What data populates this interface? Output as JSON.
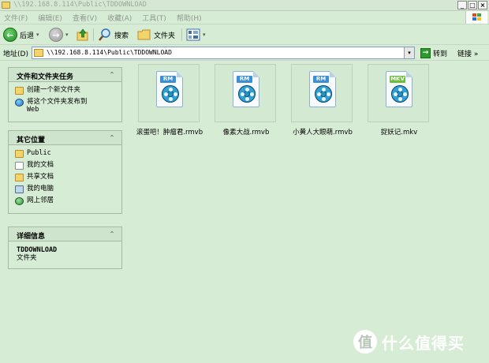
{
  "window": {
    "title": "\\\\192.168.8.114\\Public\\TDDOWNLOAD",
    "controls": [
      "_",
      "□",
      "×"
    ]
  },
  "menu": [
    "文件(F)",
    "编辑(E)",
    "查看(V)",
    "收藏(A)",
    "工具(T)",
    "帮助(H)"
  ],
  "toolbar": {
    "back_label": "后退",
    "search_label": "搜索",
    "folders_label": "文件夹",
    "back_glyph": "←",
    "forward_glyph": "→",
    "dropdown_glyph": "▾"
  },
  "address": {
    "label": "地址(D)",
    "value": "\\\\192.168.8.114\\Public\\TDDOWNLOAD",
    "go_label": "转到",
    "links_label": "链接",
    "links_chevron": "»",
    "dropdown_glyph": "▾"
  },
  "sidebar": {
    "tasks": {
      "title": "文件和文件夹任务",
      "chevron": "⌃",
      "items": [
        {
          "label": "创建一个新文件夹",
          "icon": "new-folder-icon"
        },
        {
          "label": "将这个文件夹发布到",
          "sub": "Web",
          "icon": "publish-web-icon"
        }
      ]
    },
    "places": {
      "title": "其它位置",
      "chevron": "⌃",
      "items": [
        {
          "label": "Public",
          "icon": "folder-icon"
        },
        {
          "label": "我的文档",
          "icon": "documents-icon"
        },
        {
          "label": "共享文档",
          "icon": "shared-folder-icon"
        },
        {
          "label": "我的电脑",
          "icon": "computer-icon"
        },
        {
          "label": "网上邻居",
          "icon": "network-icon"
        }
      ]
    },
    "details": {
      "title": "详细信息",
      "chevron": "⌃",
      "name": "TDDOWNLOAD",
      "type": "文件夹"
    }
  },
  "files": [
    {
      "name": "滚蛋吧！肿瘤君.rmvb",
      "badge": "RM",
      "badge_color": "#3a8fd6"
    },
    {
      "name": "像素大战.rmvb",
      "badge": "RM",
      "badge_color": "#3a8fd6"
    },
    {
      "name": "小黄人大眼萌.rmvb",
      "badge": "RM",
      "badge_color": "#3a8fd6"
    },
    {
      "name": "捉妖记.mkv",
      "badge": "MKV",
      "badge_color": "#6abf3a"
    }
  ],
  "watermark": {
    "badge": "值",
    "text": "什么值得买"
  }
}
